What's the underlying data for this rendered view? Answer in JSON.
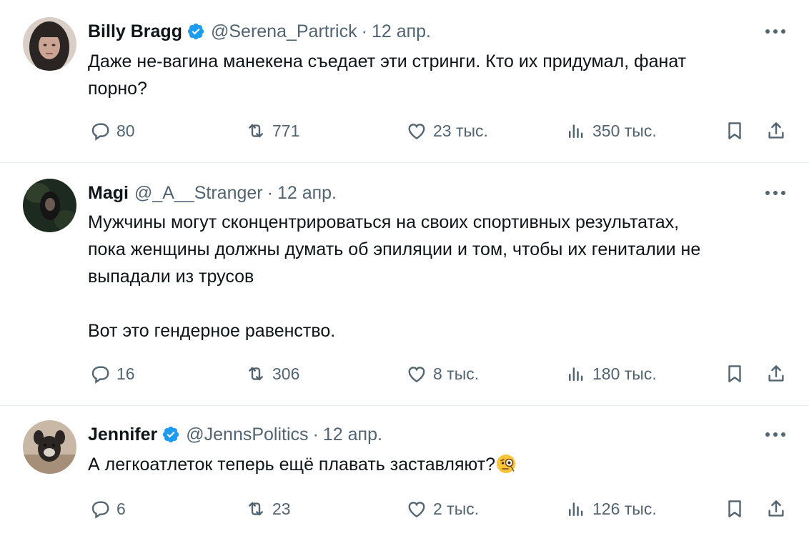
{
  "colors": {
    "verified": "#1d9bf0",
    "secondary_text": "#536471",
    "primary_text": "#0f1419",
    "divider": "#e6ecf0"
  },
  "tweets": [
    {
      "name": "Billy Bragg",
      "verified": true,
      "handle": "@Serena_Partrick",
      "separator": "·",
      "date": "12 апр.",
      "text_lines": [
        "Даже не-вагина манекена съедает эти стринги. Кто их придумал, фанат",
        "порно?"
      ],
      "replies": "80",
      "retweets": "771",
      "likes": "23 тыс.",
      "views": "350 тыс."
    },
    {
      "name": "Magi",
      "verified": false,
      "handle": "@_A__Stranger",
      "separator": "·",
      "date": "12 апр.",
      "text_lines": [
        "Мужчины могут сконцентрироваться на своих спортивных результатах,",
        "пока женщины должны думать об эпиляции и том, чтобы их гениталии не",
        "выпадали из трусов"
      ],
      "text_lines_2": [
        "Вот это гендерное равенство."
      ],
      "replies": "16",
      "retweets": "306",
      "likes": "8 тыс.",
      "views": "180 тыс."
    },
    {
      "name": "Jennifer",
      "verified": true,
      "handle": "@JennsPolitics",
      "separator": "·",
      "date": "12 апр.",
      "text": "А легкоатлеток теперь ещё плавать заставляют?",
      "emoji": "face-with-monocle-icon",
      "replies": "6",
      "retweets": "23",
      "likes": "2 тыс.",
      "views": "126 тыс."
    }
  ]
}
